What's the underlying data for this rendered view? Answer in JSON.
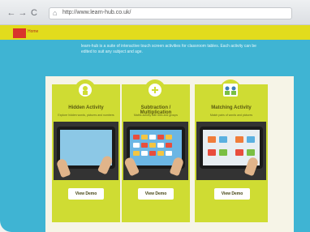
{
  "browser": {
    "back_glyph": "←",
    "forward_glyph": "→",
    "reload_glyph": "C",
    "home_glyph": "⌂",
    "url": "http://www.learn-hub.co.uk/"
  },
  "site": {
    "nav_label": "Home",
    "intro": "learn-hub is a suite of interactive touch screen activities for classroom tables. Each activity can be edited to suit any subject and age."
  },
  "cards": [
    {
      "title": "Hidden Activity",
      "subtitle": "Explore hidden words, pictures and numbers",
      "button": "View Demo",
      "icon": "reveal-icon"
    },
    {
      "title": "Subtraction / Multiplication",
      "subtitle": "Maths activity with tiles and groups",
      "button": "View Demo",
      "icon": "maths-icon"
    },
    {
      "title": "Matching Activity",
      "subtitle": "Match pairs of words and pictures",
      "button": "View Demo",
      "icon": "match-icon"
    }
  ],
  "colors": {
    "background": "#3fb4d3",
    "card": "#cfdc33",
    "nav": "#e2dc1d",
    "active_tab": "#d9342b"
  }
}
